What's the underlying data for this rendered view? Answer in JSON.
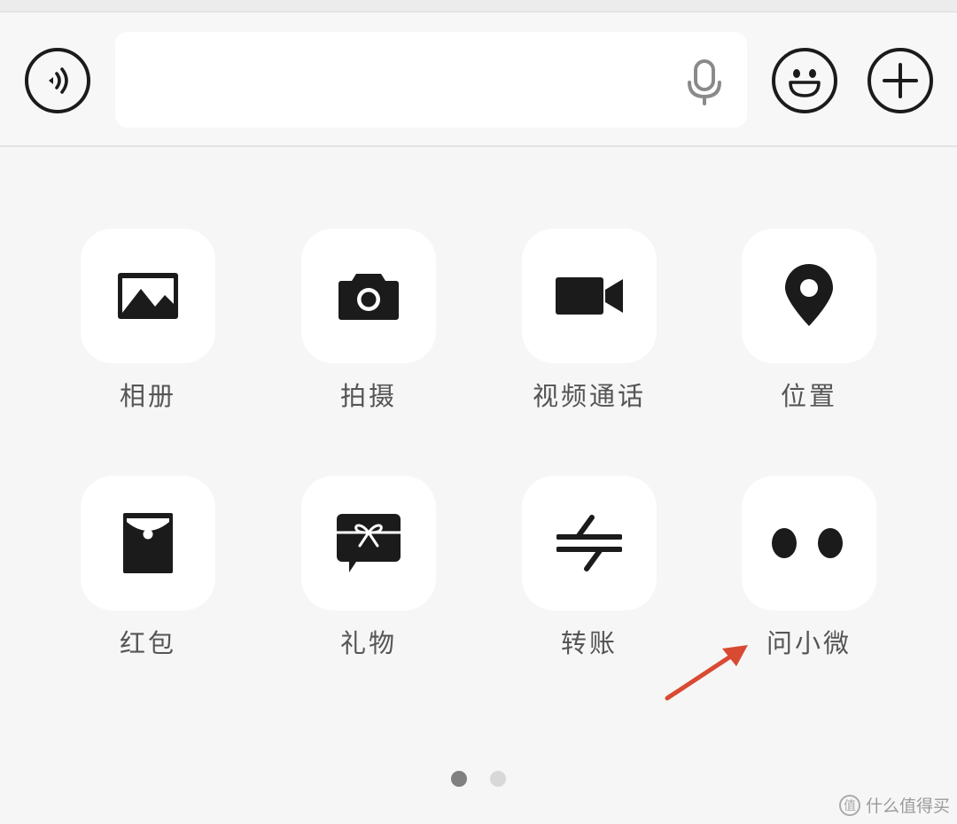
{
  "input_bar": {
    "voice_icon": "voice-waves-icon",
    "mic_icon": "microphone-icon",
    "emoji_icon": "smile-face-icon",
    "plus_icon": "plus-circle-icon",
    "text_value": ""
  },
  "panel": {
    "items": [
      {
        "label": "相册",
        "icon": "photo-album-icon"
      },
      {
        "label": "拍摄",
        "icon": "camera-icon"
      },
      {
        "label": "视频通话",
        "icon": "video-call-icon"
      },
      {
        "label": "位置",
        "icon": "location-pin-icon"
      },
      {
        "label": "红包",
        "icon": "red-packet-icon"
      },
      {
        "label": "礼物",
        "icon": "gift-icon"
      },
      {
        "label": "转账",
        "icon": "transfer-arrows-icon"
      },
      {
        "label": "问小微",
        "icon": "ask-xiaowei-eyes-icon"
      }
    ]
  },
  "annotation": {
    "arrow_color": "#d94a32"
  },
  "pager": {
    "current_page": 1,
    "total_pages": 2
  },
  "watermark": {
    "text": "什么值得买",
    "logo_glyph": "值"
  },
  "colors": {
    "icon": "#1b1b1b",
    "label": "#555555",
    "background": "#f6f6f6"
  }
}
